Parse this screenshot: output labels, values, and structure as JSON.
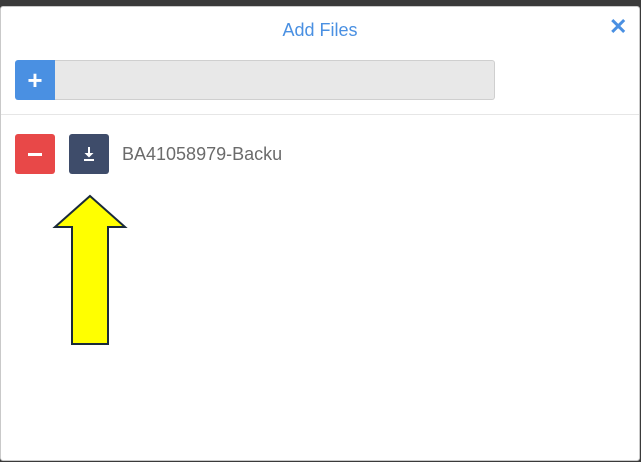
{
  "dialog": {
    "title": "Add Files",
    "close_icon": "close-icon",
    "add_icon": "plus-icon",
    "file_input_value": ""
  },
  "files": [
    {
      "name": "BA41058979-Backu",
      "remove_icon": "minus-icon",
      "download_icon": "download-icon"
    }
  ],
  "annotation": {
    "arrow_color": "#ffff00",
    "arrow_outline": "#1a2a3a",
    "points_to": "download-button"
  },
  "colors": {
    "accent": "#4a90e2",
    "remove": "#e84848",
    "download": "#3e4c6a"
  }
}
